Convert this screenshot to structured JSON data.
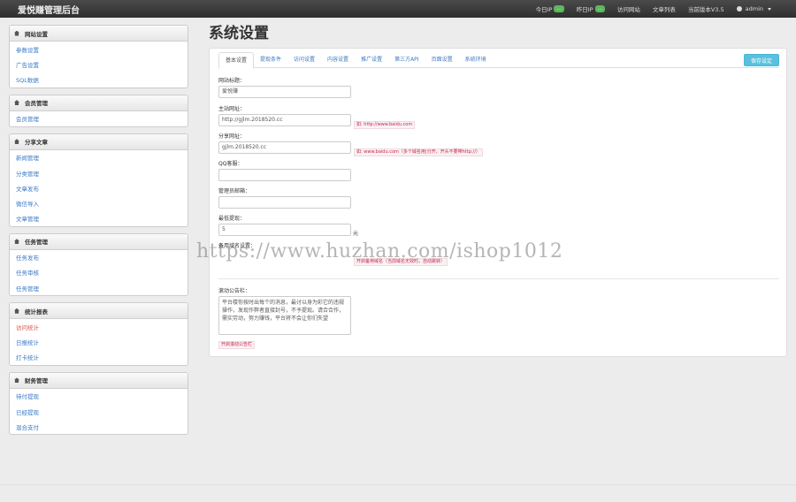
{
  "topbar": {
    "brand": "爱悦赚管理后台",
    "today_ip_label": "今日IP",
    "today_ip_value": "...",
    "yesterday_ip_label": "昨日IP",
    "yesterday_ip_value": "...",
    "site_link": "访问网站",
    "docs": "文章列表",
    "version": "当前版本V3.5",
    "user": "admin"
  },
  "sidebar": [
    {
      "title": "网站设置",
      "items": [
        "参数设置",
        "广告设置",
        "SQL数据"
      ]
    },
    {
      "title": "会员管理",
      "items": [
        "会员管理"
      ]
    },
    {
      "title": "分享文章",
      "items": [
        "新闻管理",
        "分类管理",
        "文章发布",
        "微信导入",
        "文章管理"
      ]
    },
    {
      "title": "任务管理",
      "items": [
        "任务发布",
        "任务审核",
        "任务管理"
      ]
    },
    {
      "title": "统计报表",
      "items": [
        "访问统计",
        "日报统计",
        "打卡统计"
      ]
    },
    {
      "title": "财务管理",
      "items": [
        "待付提现",
        "已经提现",
        "混合支付"
      ]
    }
  ],
  "main": {
    "title": "系统设置",
    "save_label": "保存设定",
    "tabs": [
      "基本设置",
      "提现条件",
      "访问设置",
      "内容设置",
      "推广设置",
      "第三方API",
      "页面设置",
      "系统环境"
    ],
    "fields": {
      "site_title": {
        "label": "网站标题：",
        "value": "爱悦赚"
      },
      "main_domain": {
        "label": "主站网址：",
        "value": "http://gjlm.2018520.cc",
        "hint": "如: http://www.baidu.com"
      },
      "share_domain": {
        "label": "分享网址：",
        "value": "gjlm.2018520.cc",
        "hint": "如: www.baidu.com（多个域名用|分开，开头不要带http://）"
      },
      "qq_group": {
        "label": "QQ客服：",
        "value": ""
      },
      "admin_email": {
        "label": "管理员邮箱：",
        "value": ""
      },
      "min_withdraw": {
        "label": "最低提现：",
        "value": "5",
        "unit": "元"
      },
      "other": {
        "label": "备用域名设置：",
        "hint": "开启备用域名（当前域名无效时，自动跳转）"
      },
      "notice": {
        "label": "滚动公告栏：",
        "value": "平台楼你按时出每个的消息，最讨以身为彩它的违规操作，发现作弊者直接封号，不予提现。请合合作，需实劳动，努力赚钱，平台将不会让你们失望",
        "hint": "开启滚动公告栏"
      }
    }
  },
  "watermark": "https://www.huzhan.com/ishop1012"
}
